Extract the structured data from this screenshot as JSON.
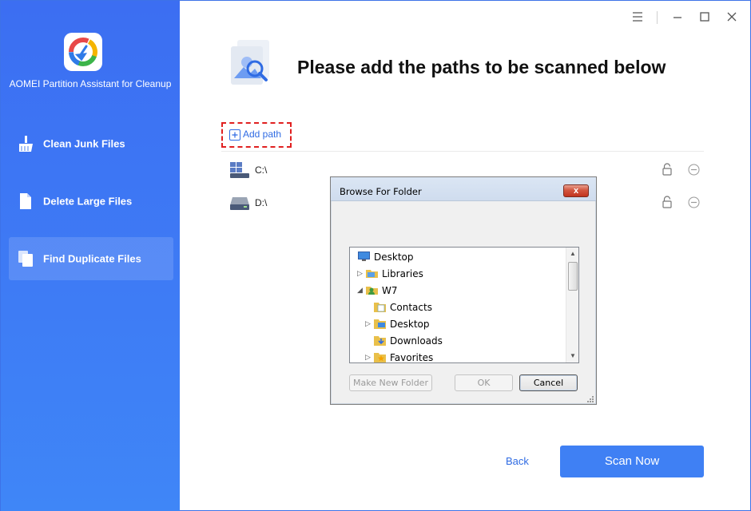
{
  "app": {
    "name": "AOMEI Partition Assistant for Cleanup",
    "accent": "#3f80f4"
  },
  "sidebar": {
    "items": [
      {
        "label": "Clean Junk Files",
        "icon": "broom-icon",
        "active": false
      },
      {
        "label": "Delete Large Files",
        "icon": "document-icon",
        "active": false
      },
      {
        "label": "Find Duplicate Files",
        "icon": "duplicate-files-icon",
        "active": true
      }
    ]
  },
  "window_controls": [
    "menu-icon",
    "minimize-icon",
    "maximize-icon",
    "close-icon"
  ],
  "main": {
    "title": "Please add the paths to be scanned below",
    "add_path_label": "Add path",
    "paths": [
      {
        "label": "C:\\",
        "icon": "windows-drive-icon"
      },
      {
        "label": "D:\\",
        "icon": "drive-icon"
      }
    ],
    "back_label": "Back",
    "scan_label": "Scan Now"
  },
  "dialog": {
    "title": "Browse For Folder",
    "close_label": "x",
    "tree": [
      {
        "label": "Desktop",
        "icon": "desktop-icon",
        "expander": ""
      },
      {
        "label": "Libraries",
        "icon": "libraries-icon",
        "expander": "▷"
      },
      {
        "label": "W7",
        "icon": "user-folder-icon",
        "expander": "◢"
      },
      {
        "label": "Contacts",
        "icon": "contacts-folder-icon",
        "expander": ""
      },
      {
        "label": "Desktop",
        "icon": "desktop-folder-icon",
        "expander": "▷"
      },
      {
        "label": "Downloads",
        "icon": "downloads-folder-icon",
        "expander": ""
      },
      {
        "label": "Favorites",
        "icon": "favorites-folder-icon",
        "expander": "▷"
      }
    ],
    "buttons": {
      "new_folder": "Make New Folder",
      "ok": "OK",
      "cancel": "Cancel"
    }
  }
}
